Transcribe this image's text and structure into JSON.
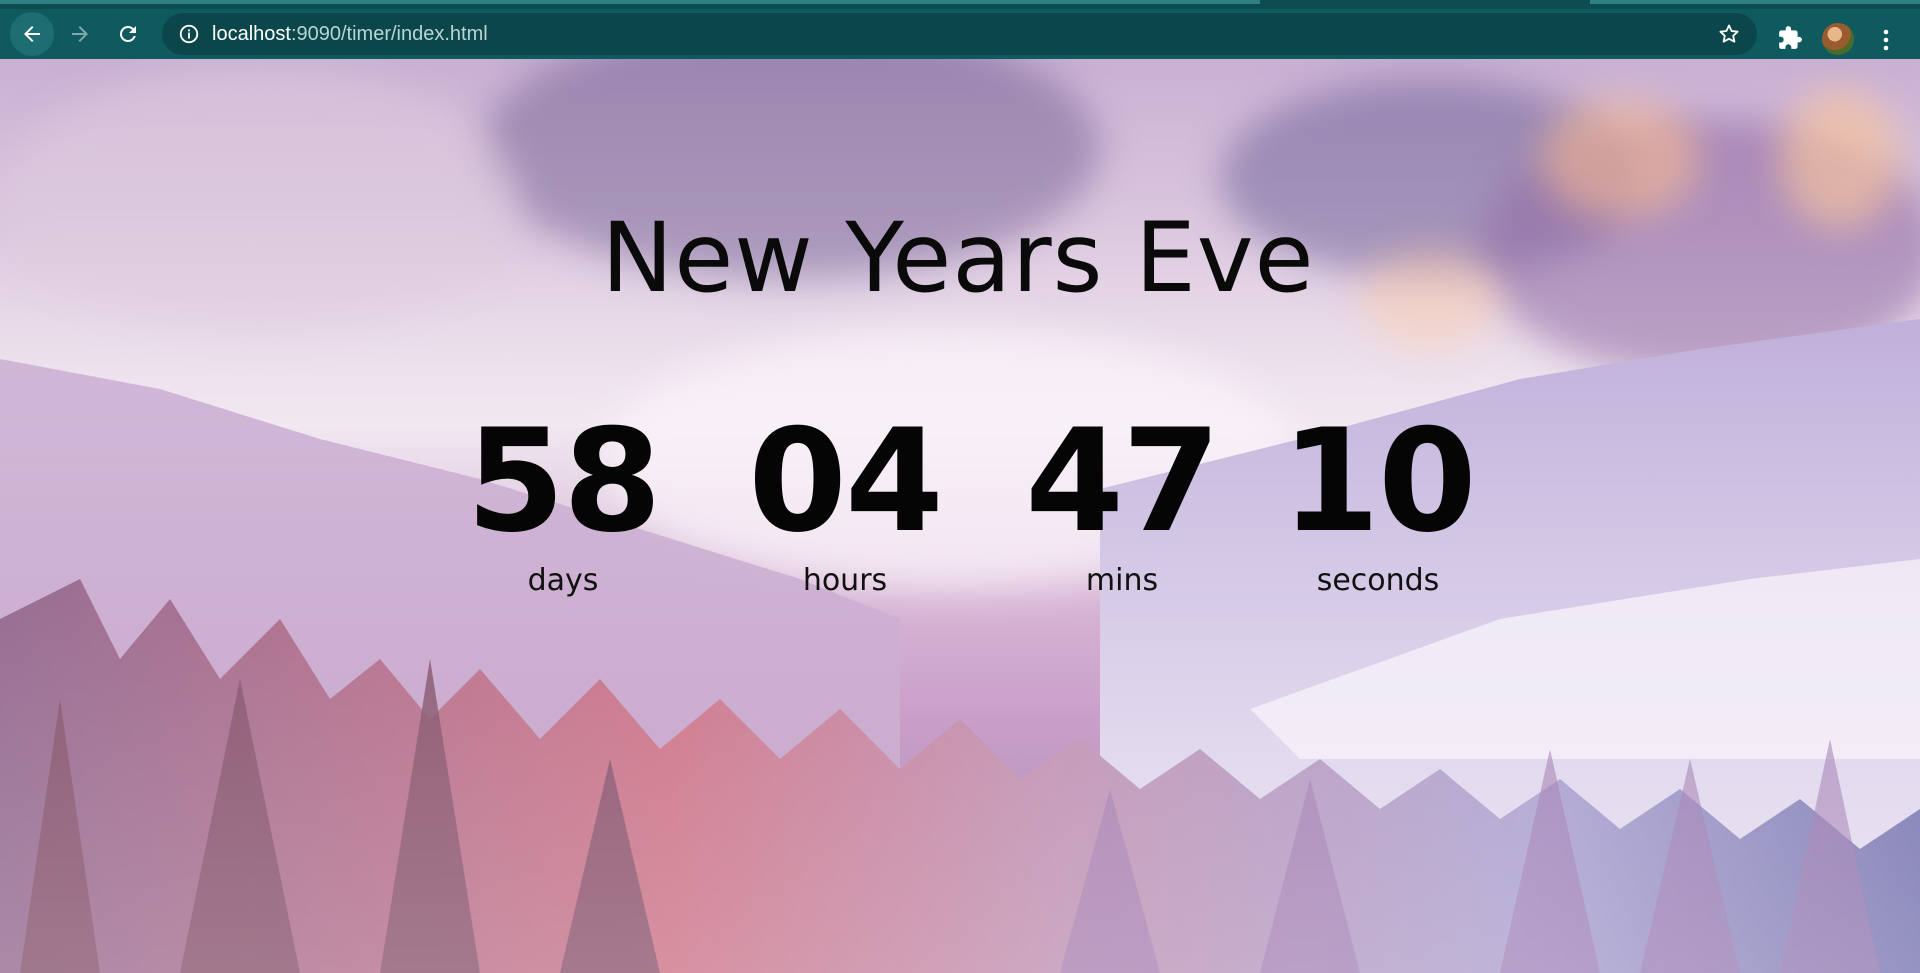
{
  "browser": {
    "url_host": "localhost",
    "url_rest": ":9090/timer/index.html",
    "chrome_color": "#0e5a5e",
    "icons": {
      "back": "arrow-left-icon",
      "forward": "arrow-right-icon",
      "reload": "reload-icon",
      "site_info": "info-icon",
      "bookmark": "star-icon",
      "extensions": "puzzle-icon",
      "profile": "avatar",
      "menu": "kebab-menu-icon"
    }
  },
  "page": {
    "title": "New Years Eve",
    "countdown": [
      {
        "value": "58",
        "label": "days"
      },
      {
        "value": "04",
        "label": "hours"
      },
      {
        "value": "47",
        "label": "mins"
      },
      {
        "value": "10",
        "label": "seconds"
      }
    ]
  }
}
